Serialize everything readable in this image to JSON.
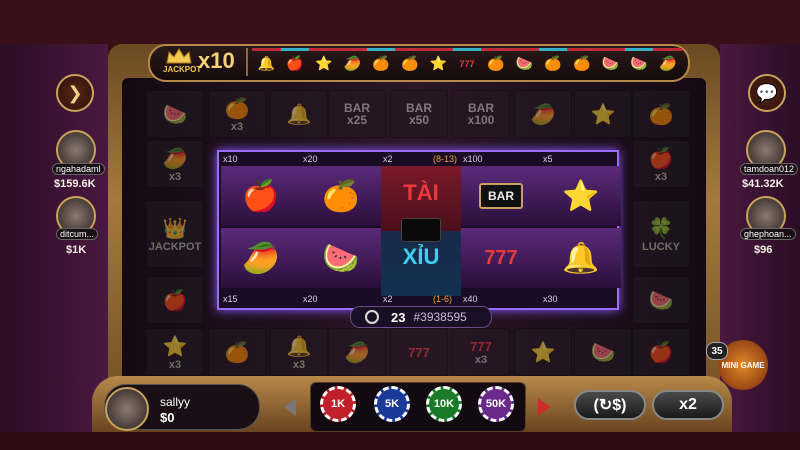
{
  "jackpot": {
    "label": "JACKPOT",
    "multiplier": "x10"
  },
  "history": [
    "🔔",
    "🍎",
    "⭐",
    "🥭",
    "🍊",
    "🍊",
    "⭐",
    "777",
    "🍊",
    "🍉",
    "🍊",
    "🍊",
    "🍉",
    "🍉",
    "🥭"
  ],
  "background": {
    "jackpot_label": "JACKPOT",
    "lucky_label": "LUCKY",
    "bars": [
      {
        "label": "BAR",
        "mult": "x25"
      },
      {
        "label": "BAR",
        "mult": "x50"
      },
      {
        "label": "BAR",
        "mult": "x100"
      }
    ],
    "x3": "x3"
  },
  "board": {
    "top_labels": [
      "x10",
      "x20",
      "x2",
      "(8-13)",
      "x100",
      "x5"
    ],
    "bottom_labels": [
      "x15",
      "x20",
      "x2",
      "(1-6)",
      "x40",
      "x30"
    ],
    "top_symbols": [
      "🍎",
      "🍊",
      "",
      "BAR",
      "⭐"
    ],
    "bottom_symbols": [
      "🥭",
      "🍉",
      "",
      "777",
      "🔔"
    ],
    "tai": "TÀI",
    "xiu": "XỈU",
    "bar_text": "BAR"
  },
  "timer": {
    "seconds": "23",
    "session": "#3938595"
  },
  "players_left": [
    {
      "name": "ngahadaml",
      "balance": "$159.6K"
    },
    {
      "name": "ditcum...",
      "balance": "$1K"
    }
  ],
  "players_right": [
    {
      "name": "tamdoan012",
      "balance": "$41.32K"
    },
    {
      "name": "ghephoan...",
      "balance": "$96"
    }
  ],
  "me": {
    "name": "sallyy",
    "balance": "$0"
  },
  "chips": [
    {
      "label": "1K",
      "color": "#c0202a"
    },
    {
      "label": "5K",
      "color": "#1a3a9a"
    },
    {
      "label": "10K",
      "color": "#1a7a2a"
    },
    {
      "label": "50K",
      "color": "#6a2a8a"
    }
  ],
  "buttons": {
    "rebet": "(↻$)",
    "double": "x2"
  },
  "mini_game": {
    "count": "35",
    "label": "MINI GAME"
  }
}
